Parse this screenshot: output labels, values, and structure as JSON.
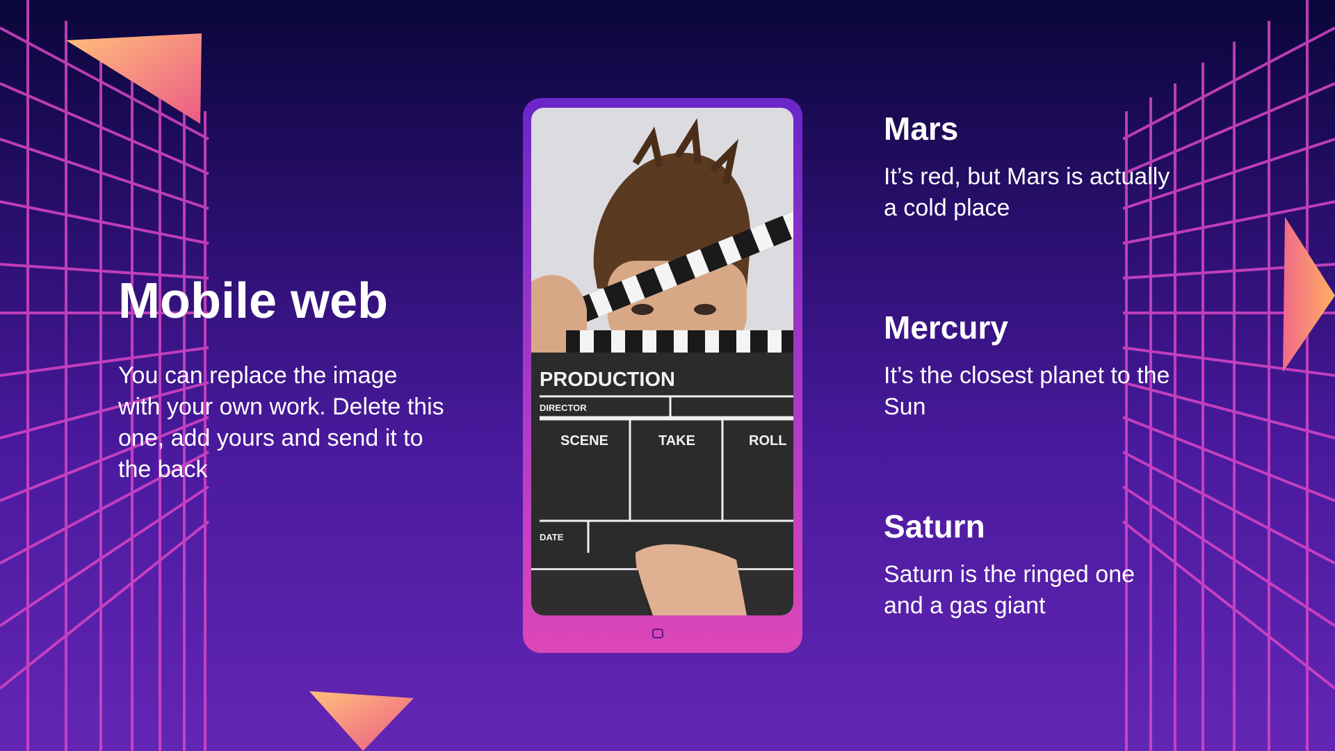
{
  "slide": {
    "title": "Mobile web",
    "description": "You can replace the image with your own work. Delete this one, add yours and send it to the back"
  },
  "planets": [
    {
      "name": "Mars",
      "description": "It’s red, but Mars is actually a cold place"
    },
    {
      "name": "Mercury",
      "description": "It’s the closest planet to the Sun"
    },
    {
      "name": "Saturn",
      "description": "Saturn is the ringed one and a gas giant"
    }
  ],
  "clapperboard": {
    "production": "PRODUCTION",
    "director": "DIRECTOR",
    "scene": "SCENE",
    "take": "TAKE",
    "roll": "ROLL",
    "date": "DATE"
  },
  "colors": {
    "background_top": "#0a063a",
    "background_bottom": "#6326b4",
    "grid": "#e04ec8",
    "phone_frame": "#b23cc6",
    "triangle_light": "#ffb468",
    "triangle_dark": "#e8507a"
  }
}
